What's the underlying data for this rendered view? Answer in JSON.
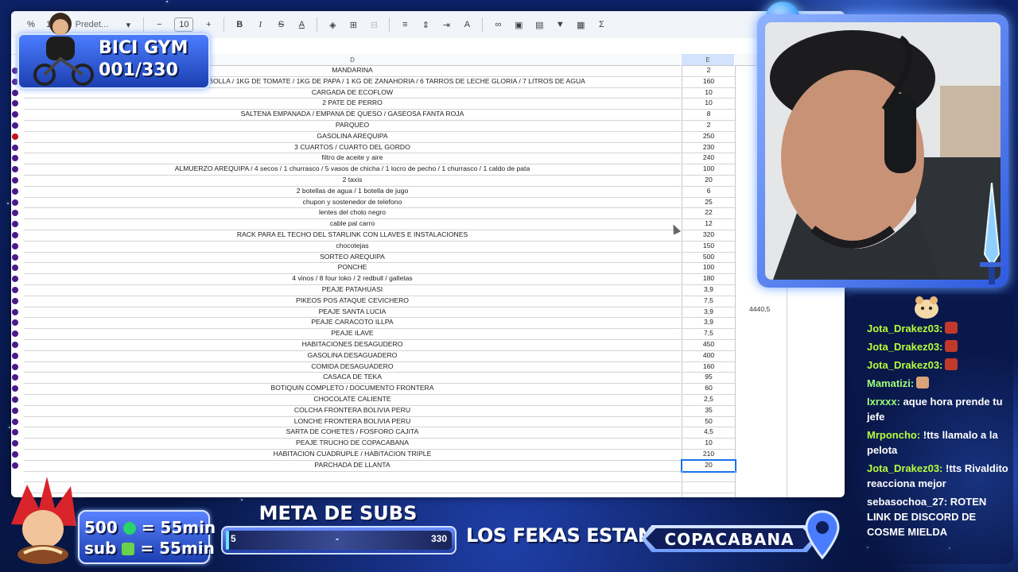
{
  "toolbar": {
    "zoom_label": "%",
    "format_label": "123",
    "font": "Predet...",
    "font_size": "10",
    "icons": [
      "minus-icon",
      "plus-icon",
      "bold-icon",
      "italic-icon",
      "strikethrough-icon",
      "text-color-icon",
      "fill-color-icon",
      "borders-icon",
      "merge-icon",
      "align-icon",
      "valign-icon",
      "wrap-icon",
      "rotate-icon",
      "link-icon",
      "comment-icon",
      "chart-icon",
      "filter-icon",
      "filter-views-icon",
      "functions-icon"
    ]
  },
  "sheet": {
    "col_d": "D",
    "col_e": "E",
    "rows": [
      {
        "d": "MANDARINA",
        "e": "2"
      },
      {
        "d": "AJO CABEZAS / 1KG DE CEBOLLA / 1KG DE TOMATE / 1KG DE PAPA / 1 KG DE ZANAHORIA / 6 TARROS DE LECHE GLORIA / 7 LITROS DE AGUA",
        "e": "160"
      },
      {
        "d": "CARGADA DE ECOFLOW",
        "e": "10"
      },
      {
        "d": "2 PATE DE PERRO",
        "e": "10"
      },
      {
        "d": "SALTENA EMPANADA / EMPANA DE QUESO / GASEOSA FANTA ROJA",
        "e": "8"
      },
      {
        "d": "PARQUEO",
        "e": "2"
      },
      {
        "d": "GASOLINA AREQUIPA",
        "e": "250"
      },
      {
        "d": "3 CUARTOS / CUARTO DEL GORDO",
        "e": "230"
      },
      {
        "d": "filtro de aceite y aire",
        "e": "240"
      },
      {
        "d": "ALMUERZO AREQUIPA / 4 secos / 1 churrasco / 5 vasos de chicha / 1 locro de pecho / 1 churrasco / 1 caldo de pata",
        "e": "100"
      },
      {
        "d": "2 taxis",
        "e": "20"
      },
      {
        "d": "2 botellas de agua / 1 botella de jugo",
        "e": "6"
      },
      {
        "d": "chupon y sostenedor de telefono",
        "e": "25"
      },
      {
        "d": "lentes del cholo negro",
        "e": "22"
      },
      {
        "d": "cable pal carro",
        "e": "12"
      },
      {
        "d": "RACK PARA EL TECHO DEL STARLINK CON LLAVES E INSTALACIONES",
        "e": "320"
      },
      {
        "d": "chocotejas",
        "e": "150"
      },
      {
        "d": "SORTEO AREQUIPA",
        "e": "500"
      },
      {
        "d": "PONCHE",
        "e": "100"
      },
      {
        "d": "4 vinos / 8 four loko / 2 redbull / galletas",
        "e": "180"
      },
      {
        "d": "PEAJE PATAHUASI",
        "e": "3,9"
      },
      {
        "d": "PIKEOS POS ATAQUE CEVICHERO",
        "e": "7,5"
      },
      {
        "d": "PEAJE SANTA LUCIA",
        "e": "3,9"
      },
      {
        "d": "PEAJE CARACOTO ILLPA",
        "e": "3,9"
      },
      {
        "d": "PEAJE ILAVE",
        "e": "7,5"
      },
      {
        "d": "HABITACIONES DESAGUDERO",
        "e": "450"
      },
      {
        "d": "GASOLINA DESAGUADERO",
        "e": "400"
      },
      {
        "d": "COMIDA DESAGUADERO",
        "e": "160"
      },
      {
        "d": "CASACA DE TEKA",
        "e": "95"
      },
      {
        "d": "BOTIQUIN COMPLETO / DOCUMENTO FRONTERA",
        "e": "60"
      },
      {
        "d": "CHOCOLATE CALIENTE",
        "e": "2,5"
      },
      {
        "d": "COLCHA FRONTERA BOLIVIA PERU",
        "e": "35"
      },
      {
        "d": "LONCHE FRONTERA BOLIVIA PERU",
        "e": "50"
      },
      {
        "d": "SARTA DE COHETES / FOSFORO CAJITA",
        "e": "4,5"
      },
      {
        "d": "PEAJE TRUCHO DE COPACABANA",
        "e": "10"
      },
      {
        "d": "HABITACION CUADRUPLE / HABITACION TRIPLE",
        "e": "210"
      },
      {
        "d": "PARCHADA DE LLANTA",
        "e": "20"
      }
    ],
    "total": "4440,5"
  },
  "overlay": {
    "bici_title": "BICI GYM",
    "bici_count": "001/330",
    "subs_line1": "500",
    "subs_line1_rest": "= 55min",
    "subs_line2": "sub",
    "subs_line2_rest": "= 55min",
    "meta_title": "META DE SUBS",
    "meta_start": "5",
    "meta_mid": "-",
    "meta_end": "330",
    "meta_progress": 0.015,
    "fekas": "LOS FEKAS ESTAN EN:",
    "location": "COPACABANA",
    "accent": "#1c3fb0"
  },
  "chat": [
    {
      "user": "Jota_Drakez03:",
      "text": "",
      "emote": "#c0392b",
      "color": "#b7ff3b"
    },
    {
      "user": "Jota_Drakez03:",
      "text": "",
      "emote": "#c0392b",
      "color": "#b7ff3b"
    },
    {
      "user": "Jota_Drakez03:",
      "text": "",
      "emote": "#c0392b",
      "color": "#b7ff3b"
    },
    {
      "user": "Mamatizi:",
      "text": "",
      "emote": "#d9a27a",
      "color": "#9dff7a"
    },
    {
      "user": "Ixrxxx:",
      "text": "aque hora prende tu jefe",
      "color": "#9dff7a"
    },
    {
      "user": "Mrponcho:",
      "text": "!tts llamalo a la pelota",
      "color": "#b7ff3b"
    },
    {
      "user": "Jota_Drakez03:",
      "text": "!tts Rivaldito reacciona mejor",
      "color": "#b7ff3b"
    },
    {
      "user": "sebasochoa_27:",
      "text": "ROTEN LINK DE DISCORD DE COSME MIELDA",
      "color": "#ffffff"
    }
  ]
}
